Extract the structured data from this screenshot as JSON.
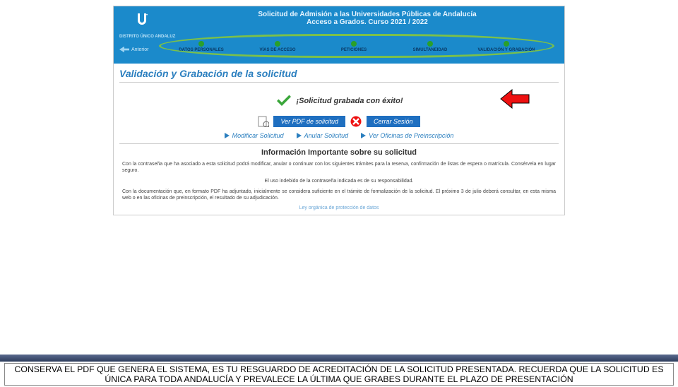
{
  "header": {
    "title1": "Solicitud de Admisión a las Universidades Públicas de Andalucía",
    "title2": "Acceso a Grados. Curso 2021 / 2022",
    "distrito": "DISTRITO ÚNICO ANDALUZ",
    "back": "Anterior",
    "steps": [
      "DATOS PERSONALES",
      "VÍAS DE ACCESO",
      "PETICIONES",
      "SIMULTANEIDAD",
      "VALIDACIÓN Y GRABACIÓN"
    ]
  },
  "main": {
    "section_title": "Validación y Grabación de la solicitud",
    "success": "¡Solicitud grabada con éxito!",
    "btn_pdf": "Ver PDF de solicitud",
    "btn_close": "Cerrar Sesión",
    "link_modify": "Modificar Solicitud",
    "link_cancel": "Anular Solicitud",
    "link_offices": "Ver Oficinas de Preinscripción",
    "info_title": "Información Importante sobre su solicitud",
    "p1": "Con la contraseña que ha asociado a esta solicitud podrá modificar, anular o continuar con los siguientes trámites para la reserva, confirmación de listas de espera o matrícula. Consérvela en lugar seguro.",
    "p2": "El uso indebido de la contraseña indicada es de su responsabilidad.",
    "p3": "Con la documentación que, en formato PDF ha adjuntado, inicialmente se considera suficiente en el trámite de formalización de la solicitud. El próximo 3 de julio deberá consultar, en esta misma web o en las oficinas de preinscripción, el resultado de su adjudicación.",
    "legal": "Ley orgánica de protección de datos"
  },
  "footer": {
    "note": "CONSERVA EL PDF QUE GENERA EL SISTEMA, ES TU RESGUARDO DE ACREDITACIÓN DE LA SOLICITUD PRESENTADA. RECUERDA QUE LA SOLICITUD ES ÚNICA PARA TODA ANDALUCÍA Y PREVALECE LA ÚLTIMA QUE GRABES DURANTE EL PLAZO DE PRESENTACIÓN"
  }
}
